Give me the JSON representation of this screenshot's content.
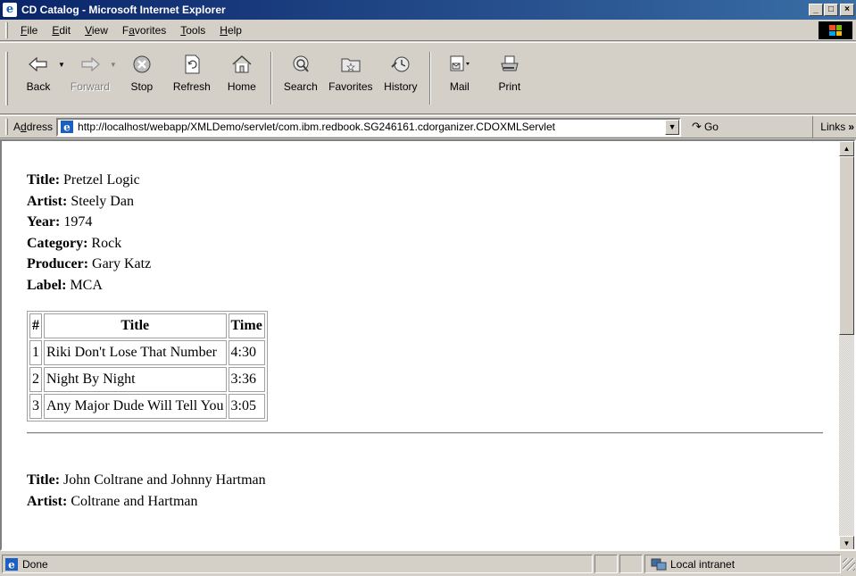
{
  "window": {
    "title": "CD Catalog - Microsoft Internet Explorer",
    "controls": [
      "_",
      "□",
      "×"
    ]
  },
  "menu": [
    {
      "label": "File",
      "mnemonic": "F"
    },
    {
      "label": "Edit",
      "mnemonic": "E"
    },
    {
      "label": "View",
      "mnemonic": "V"
    },
    {
      "label": "Favorites",
      "mnemonic": "a"
    },
    {
      "label": "Tools",
      "mnemonic": "T"
    },
    {
      "label": "Help",
      "mnemonic": "H"
    }
  ],
  "toolbar": {
    "back": "Back",
    "forward": "Forward",
    "stop": "Stop",
    "refresh": "Refresh",
    "home": "Home",
    "search": "Search",
    "favorites": "Favorites",
    "history": "History",
    "mail": "Mail",
    "print": "Print"
  },
  "address": {
    "label": "Address",
    "url": "http://localhost/webapp/XMLDemo/servlet/com.ibm.redbook.SG246161.cdorganizer.CDOXMLServlet",
    "go": "Go",
    "links": "Links",
    "links_chevron": "»"
  },
  "cds": [
    {
      "fields": [
        {
          "label": "Title:",
          "value": "Pretzel Logic"
        },
        {
          "label": "Artist:",
          "value": "Steely Dan"
        },
        {
          "label": "Year:",
          "value": "1974"
        },
        {
          "label": "Category:",
          "value": "Rock"
        },
        {
          "label": "Producer:",
          "value": "Gary Katz"
        },
        {
          "label": "Label:",
          "value": "MCA"
        }
      ],
      "columns": [
        "#",
        "Title",
        "Time"
      ],
      "tracks": [
        [
          "1",
          "Riki Don't Lose That Number",
          "4:30"
        ],
        [
          "2",
          "Night By Night",
          "3:36"
        ],
        [
          "3",
          "Any Major Dude Will Tell You",
          "3:05"
        ]
      ]
    },
    {
      "fields": [
        {
          "label": "Title:",
          "value": "John Coltrane and Johnny Hartman"
        },
        {
          "label": "Artist:",
          "value": "Coltrane and Hartman"
        }
      ]
    }
  ],
  "status": {
    "text": "Done",
    "zone": "Local intranet"
  }
}
